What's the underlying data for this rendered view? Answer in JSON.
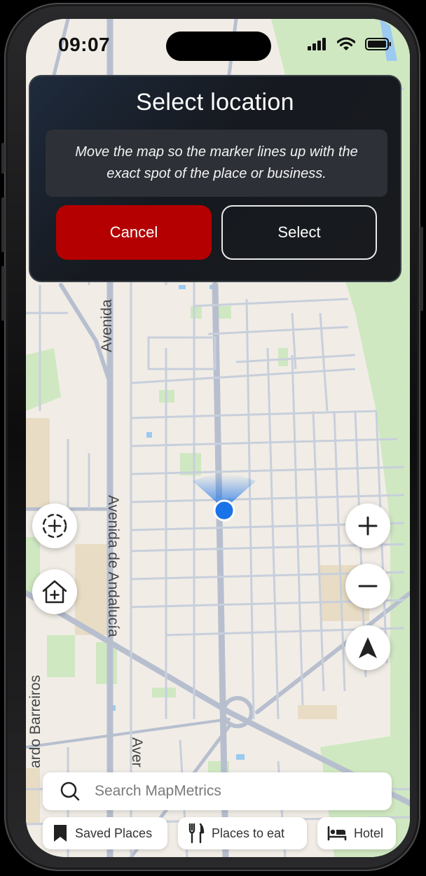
{
  "status_bar": {
    "time": "09:07",
    "icons": [
      "signal-icon",
      "wifi-icon",
      "battery-icon"
    ]
  },
  "dialog": {
    "title": "Select location",
    "message": "Move the map so the marker lines up with the exact spot of the place or business.",
    "cancel_label": "Cancel",
    "select_label": "Select"
  },
  "map": {
    "street_labels": [
      "Avenida",
      "Avenida de Andalucía",
      "ardo Barreiros",
      "Aver"
    ],
    "colors": {
      "land": "#f1ede6",
      "park": "#cfe8c1",
      "road": "#c3cad8",
      "marker": "#1a73e8"
    }
  },
  "controls": {
    "left": [
      "recenter-plus-icon",
      "home-plus-icon"
    ],
    "right": [
      "zoom-in-icon",
      "zoom-out-icon",
      "compass-arrow-icon"
    ]
  },
  "search": {
    "placeholder": "Search MapMetrics"
  },
  "chips": [
    {
      "label": "Saved Places",
      "icon": "bookmark-icon"
    },
    {
      "label": "Places to eat",
      "icon": "fork-knife-icon"
    },
    {
      "label": "Hotel",
      "icon": "bed-icon"
    }
  ],
  "colors": {
    "cancel": "#b40000",
    "dialog_bg": "#16191f"
  }
}
